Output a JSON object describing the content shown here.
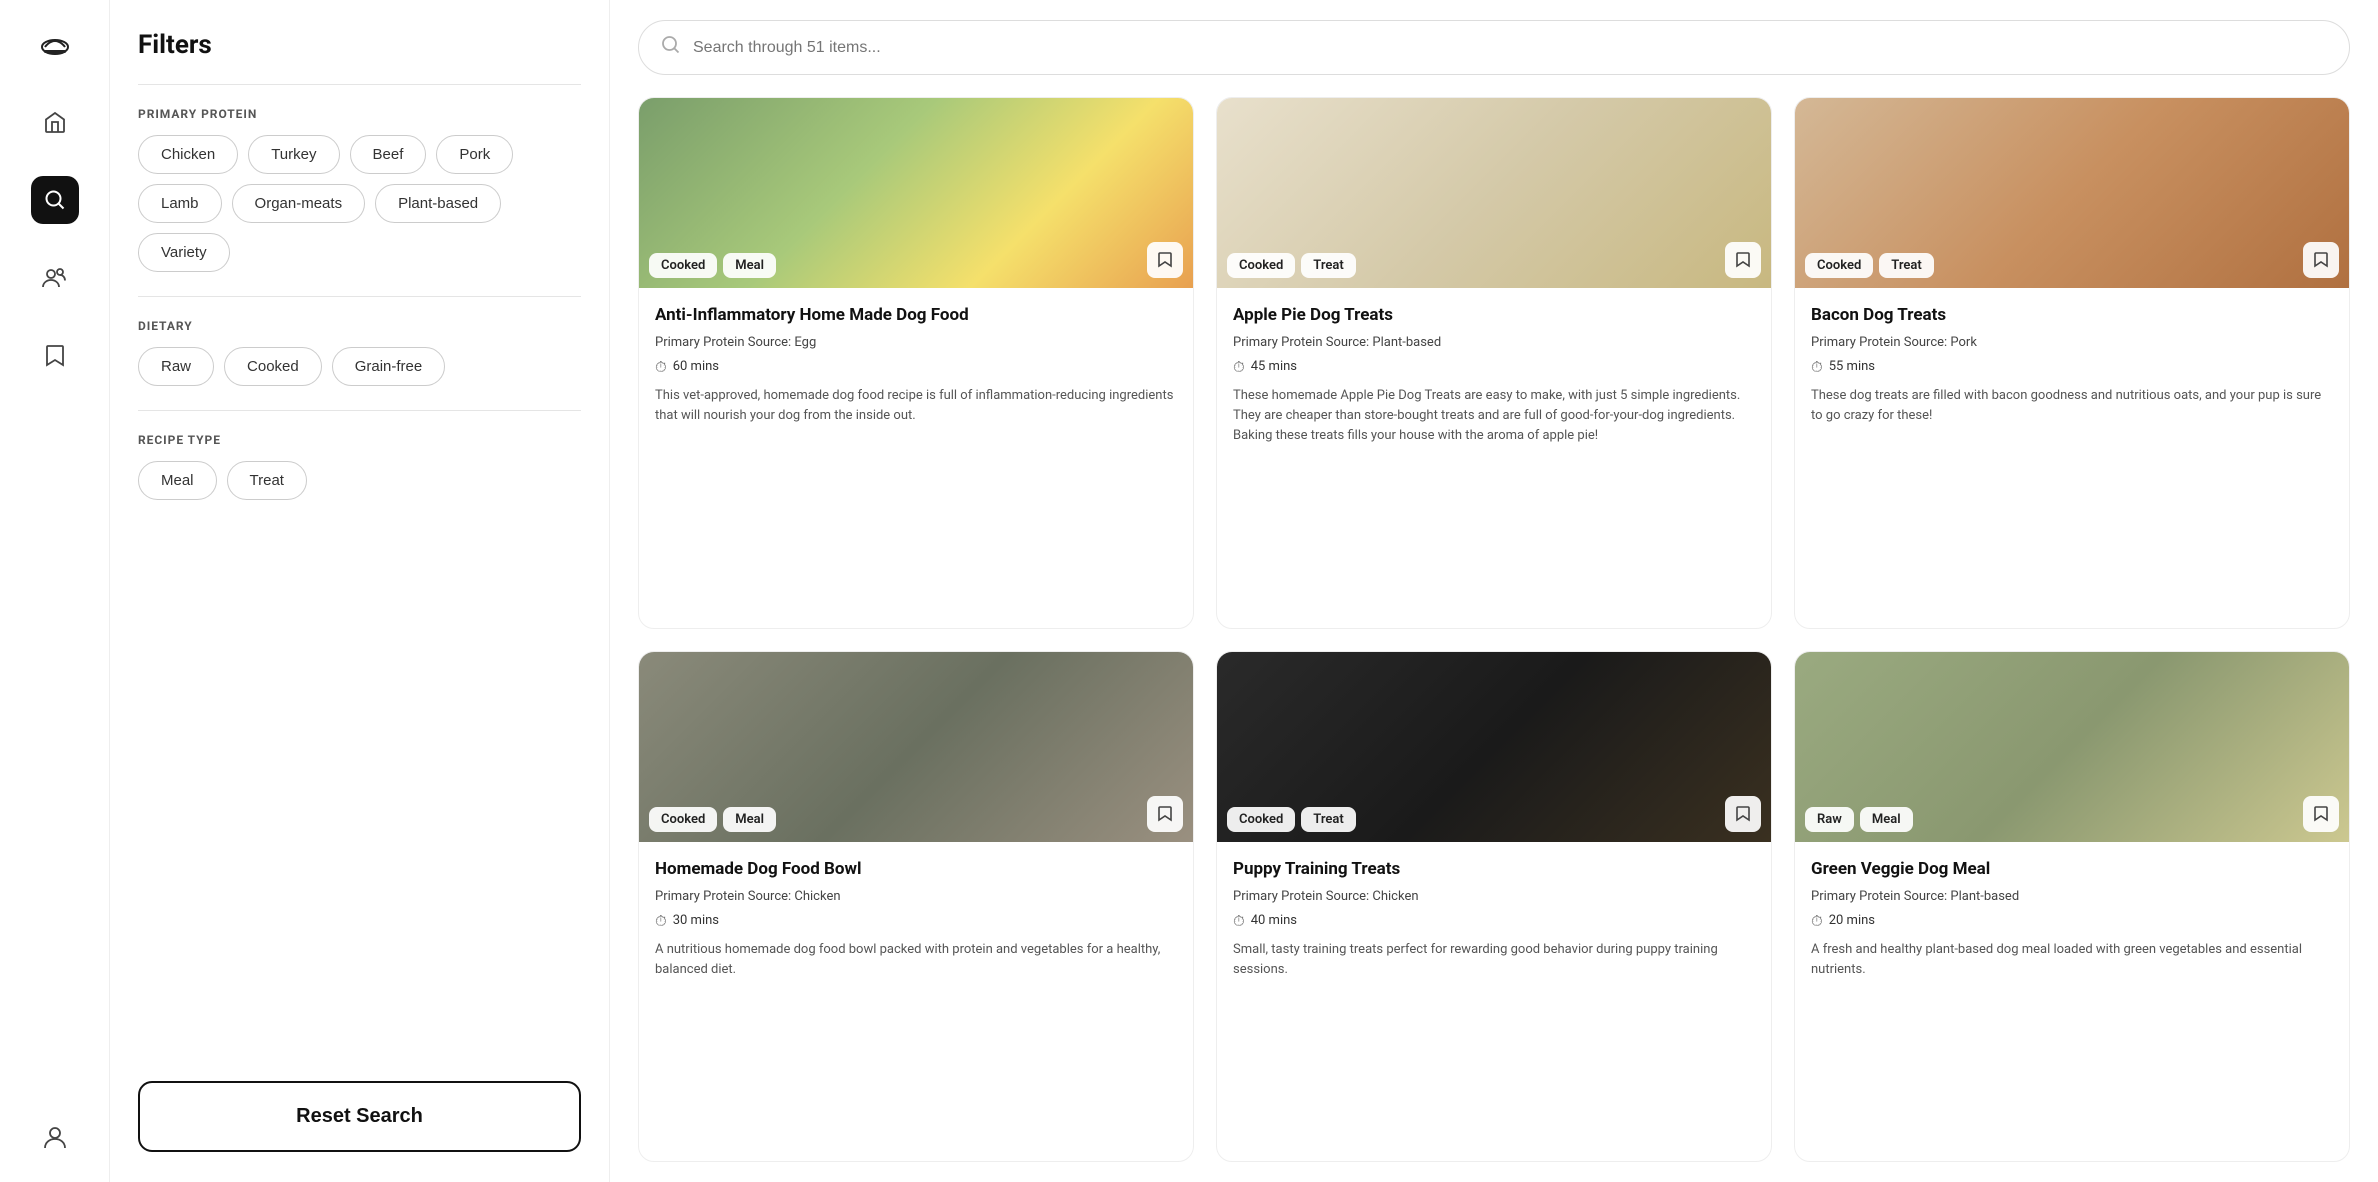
{
  "sidebar": {
    "icons": [
      {
        "name": "bowl-icon",
        "glyph": "🍜",
        "active": false
      },
      {
        "name": "home-icon",
        "glyph": "🏠",
        "active": false
      },
      {
        "name": "search-icon",
        "glyph": "🔍",
        "active": true
      },
      {
        "name": "group-icon",
        "glyph": "👥",
        "active": false
      },
      {
        "name": "bookmark-icon",
        "glyph": "🔖",
        "active": false
      },
      {
        "name": "profile-icon",
        "glyph": "👤",
        "active": false
      }
    ]
  },
  "filters": {
    "title": "Filters",
    "sections": [
      {
        "label": "PRIMARY PROTEIN",
        "chips": [
          "Chicken",
          "Turkey",
          "Beef",
          "Pork",
          "Lamb",
          "Organ-meats",
          "Plant-based",
          "Variety"
        ]
      },
      {
        "label": "DIETARY",
        "chips": [
          "Raw",
          "Cooked",
          "Grain-free"
        ]
      },
      {
        "label": "RECIPE TYPE",
        "chips": [
          "Meal",
          "Treat"
        ]
      }
    ],
    "reset_label": "Reset Search"
  },
  "search": {
    "placeholder": "Search through 51 items..."
  },
  "recipes": [
    {
      "title": "Anti-Inflammatory Home Made Dog Food",
      "tags": [
        "Cooked",
        "Meal"
      ],
      "protein": "Primary Protein Source: Egg",
      "time": "60 mins",
      "description": "This vet-approved, homemade dog food recipe is full of inflammation-reducing ingredients that will nourish your dog from the inside out.",
      "img_class": "img-1"
    },
    {
      "title": "Apple Pie Dog Treats",
      "tags": [
        "Cooked",
        "Treat"
      ],
      "protein": "Primary Protein Source: Plant-based",
      "time": "45 mins",
      "description": "These homemade Apple Pie Dog Treats are easy to make, with just 5 simple ingredients. They are cheaper than store-bought treats and are full of good-for-your-dog ingredients. Baking these treats fills your house with the aroma of apple pie!",
      "img_class": "img-2"
    },
    {
      "title": "Bacon Dog Treats",
      "tags": [
        "Cooked",
        "Treat"
      ],
      "protein": "Primary Protein Source: Pork",
      "time": "55 mins",
      "description": "These dog treats are filled with bacon goodness and nutritious oats, and your pup is sure to go crazy for these!",
      "img_class": "img-3"
    },
    {
      "title": "Homemade Dog Food Bowl",
      "tags": [
        "Cooked",
        "Meal"
      ],
      "protein": "Primary Protein Source: Chicken",
      "time": "30 mins",
      "description": "A nutritious homemade dog food bowl packed with protein and vegetables for a healthy, balanced diet.",
      "img_class": "img-4"
    },
    {
      "title": "Puppy Training Treats",
      "tags": [
        "Cooked",
        "Treat"
      ],
      "protein": "Primary Protein Source: Chicken",
      "time": "40 mins",
      "description": "Small, tasty training treats perfect for rewarding good behavior during puppy training sessions.",
      "img_class": "img-5"
    },
    {
      "title": "Green Veggie Dog Meal",
      "tags": [
        "Raw",
        "Meal"
      ],
      "protein": "Primary Protein Source: Plant-based",
      "time": "20 mins",
      "description": "A fresh and healthy plant-based dog meal loaded with green vegetables and essential nutrients.",
      "img_class": "img-6"
    }
  ]
}
